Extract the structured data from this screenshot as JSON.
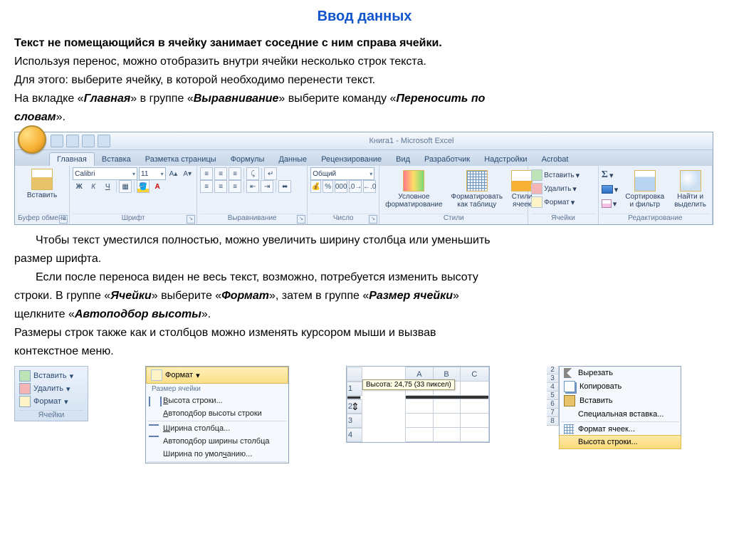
{
  "title": "Ввод данных",
  "p1_bold": "Текст не помещающийся в ячейку занимает соседние с ним справа ячейки.",
  "p2": "Используя перенос, можно отобразить внутри ячейки несколько строк текста.",
  "p3": "Для этого: выберите ячейку, в которой необходимо перенести текст.",
  "p4_a": "На вкладке «",
  "p4_b1": "Главная",
  "p4_c": "» в группе «",
  "p4_b2": "Выравнивание",
  "p4_d": "» выберите команду «",
  "p4_b3": "Переносить по",
  "p4_b4": "словам",
  "p4_e": "».",
  "p5_a": "Чтобы текст уместился полностью, можно увеличить ширину столбца или уменьшить",
  "p5_b": "размер шрифта.",
  "p6_a": "Если после переноса виден не весь текст, возможно, потребуется изменить высоту",
  "p6_b_a": "строки. В группе «",
  "p6_b1": "Ячейки",
  "p6_b_b": "» выберите «",
  "p6_b2": "Формат",
  "p6_b_c": "», затем в группе «",
  "p6_b3": "Размер ячейки",
  "p6_b_d": "»",
  "p6_c_a": "щелкните «",
  "p6_c_b": "Автоподбор высоты",
  "p6_c_c": "».",
  "p7_a": "Размеры строк также как и столбцов можно изменять курсором мыши и вызвав",
  "p7_b": "контекстное меню.",
  "ribbon": {
    "window_title": "Книга1 - Microsoft Excel",
    "tabs": [
      "Главная",
      "Вставка",
      "Разметка страницы",
      "Формулы",
      "Данные",
      "Рецензирование",
      "Вид",
      "Разработчик",
      "Надстройки",
      "Acrobat"
    ],
    "paste": "Вставить",
    "font_name": "Calibri",
    "font_size": "11",
    "number_format": "Общий",
    "cond_fmt": "Условное\nформатирование",
    "as_table": "Форматировать\nкак таблицу",
    "cell_styles": "Стили\nячеек",
    "insert": "Вставить",
    "delete": "Удалить",
    "format": "Формат",
    "sort": "Сортировка\nи фильтр",
    "find": "Найти и\nвыделить",
    "groups": {
      "clipboard": "Буфер обмена",
      "font": "Шрифт",
      "alignment": "Выравнивание",
      "number": "Число",
      "styles": "Стили",
      "cells": "Ячейки",
      "editing": "Редактирование"
    }
  },
  "cells_panel": {
    "insert": "Вставить",
    "delete": "Удалить",
    "format": "Формат",
    "label": "Ячейки"
  },
  "fmt_menu": {
    "button": "Формат",
    "section": "Размер ячейки",
    "row_height": "Высота строки...",
    "autofit_row": "Автоподбор высоты строки",
    "col_width": "Ширина столбца...",
    "autofit_col": "Автоподбор ширины столбца",
    "default_width": "Ширина по умолчанию..."
  },
  "sheet": {
    "cols": [
      "A",
      "B",
      "C"
    ],
    "rows": [
      "1",
      "2",
      "3",
      "4"
    ],
    "tooltip": "Высота: 24,75 (33 пиксел)"
  },
  "ctx": {
    "rows": [
      "2",
      "3",
      "4",
      "5",
      "6",
      "7",
      "8"
    ],
    "cut": "Вырезать",
    "copy": "Копировать",
    "paste": "Вставить",
    "paste_special": "Специальная вставка...",
    "format_cells": "Формат ячеек...",
    "row_height": "Высота строки..."
  }
}
